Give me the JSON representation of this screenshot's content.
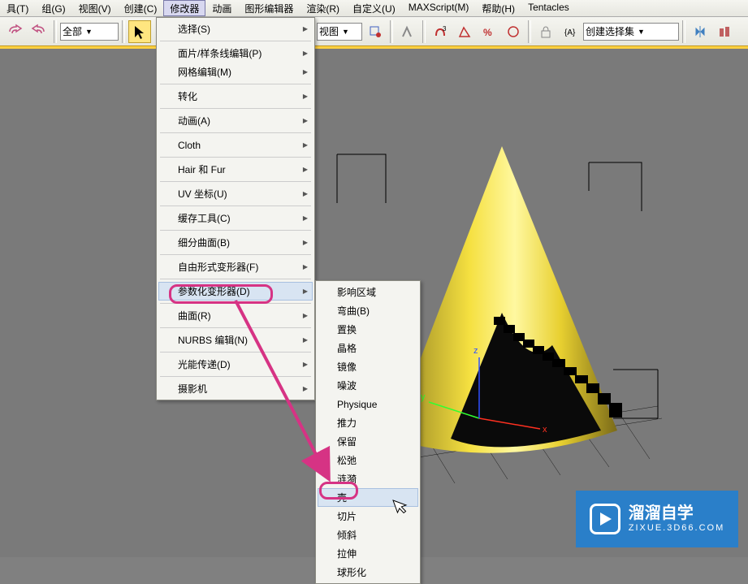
{
  "menubar": {
    "items": [
      {
        "label": "具(T)"
      },
      {
        "label": "组(G)"
      },
      {
        "label": "视图(V)"
      },
      {
        "label": "创建(C)"
      },
      {
        "label": "修改器"
      },
      {
        "label": "动画"
      },
      {
        "label": "图形编辑器"
      },
      {
        "label": "渲染(R)"
      },
      {
        "label": "自定义(U)"
      },
      {
        "label": "MAXScript(M)"
      },
      {
        "label": "帮助(H)"
      },
      {
        "label": "Tentacles"
      }
    ],
    "active_index": 4
  },
  "toolbar": {
    "selection_set_label": "全部",
    "view_label": "视图",
    "named_sel_label": "创建选择集"
  },
  "menu1": {
    "items": [
      {
        "label": "选择(S)",
        "sub": true
      },
      {
        "sep": true
      },
      {
        "label": "面片/样条线编辑(P)",
        "sub": true
      },
      {
        "label": "网格编辑(M)",
        "sub": true
      },
      {
        "sep": true
      },
      {
        "label": "转化",
        "sub": true
      },
      {
        "sep": true
      },
      {
        "label": "动画(A)",
        "sub": true
      },
      {
        "sep": true
      },
      {
        "label": "Cloth",
        "sub": true
      },
      {
        "sep": true
      },
      {
        "label": "Hair 和 Fur",
        "sub": true
      },
      {
        "sep": true
      },
      {
        "label": "UV 坐标(U)",
        "sub": true
      },
      {
        "sep": true
      },
      {
        "label": "缓存工具(C)",
        "sub": true
      },
      {
        "sep": true
      },
      {
        "label": "细分曲面(B)",
        "sub": true
      },
      {
        "sep": true
      },
      {
        "label": "自由形式变形器(F)",
        "sub": true
      },
      {
        "sep": true
      },
      {
        "label": "参数化变形器(D)",
        "sub": true,
        "hover": true
      },
      {
        "sep": true
      },
      {
        "label": "曲面(R)",
        "sub": true
      },
      {
        "sep": true
      },
      {
        "label": "NURBS 编辑(N)",
        "sub": true
      },
      {
        "sep": true
      },
      {
        "label": "光能传递(D)",
        "sub": true
      },
      {
        "sep": true
      },
      {
        "label": "摄影机",
        "sub": true
      }
    ]
  },
  "menu2": {
    "items": [
      {
        "label": "影响区域"
      },
      {
        "label": "弯曲(B)"
      },
      {
        "label": "置换"
      },
      {
        "label": "晶格"
      },
      {
        "label": "镜像"
      },
      {
        "label": "噪波"
      },
      {
        "label": "Physique"
      },
      {
        "label": "推力"
      },
      {
        "label": "保留"
      },
      {
        "label": "松弛"
      },
      {
        "label": "涟漪"
      },
      {
        "label": "壳",
        "hover": true
      },
      {
        "label": "切片"
      },
      {
        "label": "倾斜"
      },
      {
        "label": "拉伸"
      },
      {
        "label": "球形化"
      }
    ]
  },
  "gizmo": {
    "x": "x",
    "y": "y",
    "z": "z"
  },
  "watermark": {
    "title": "溜溜自学",
    "sub": "ZIXUE.3D66.COM"
  }
}
